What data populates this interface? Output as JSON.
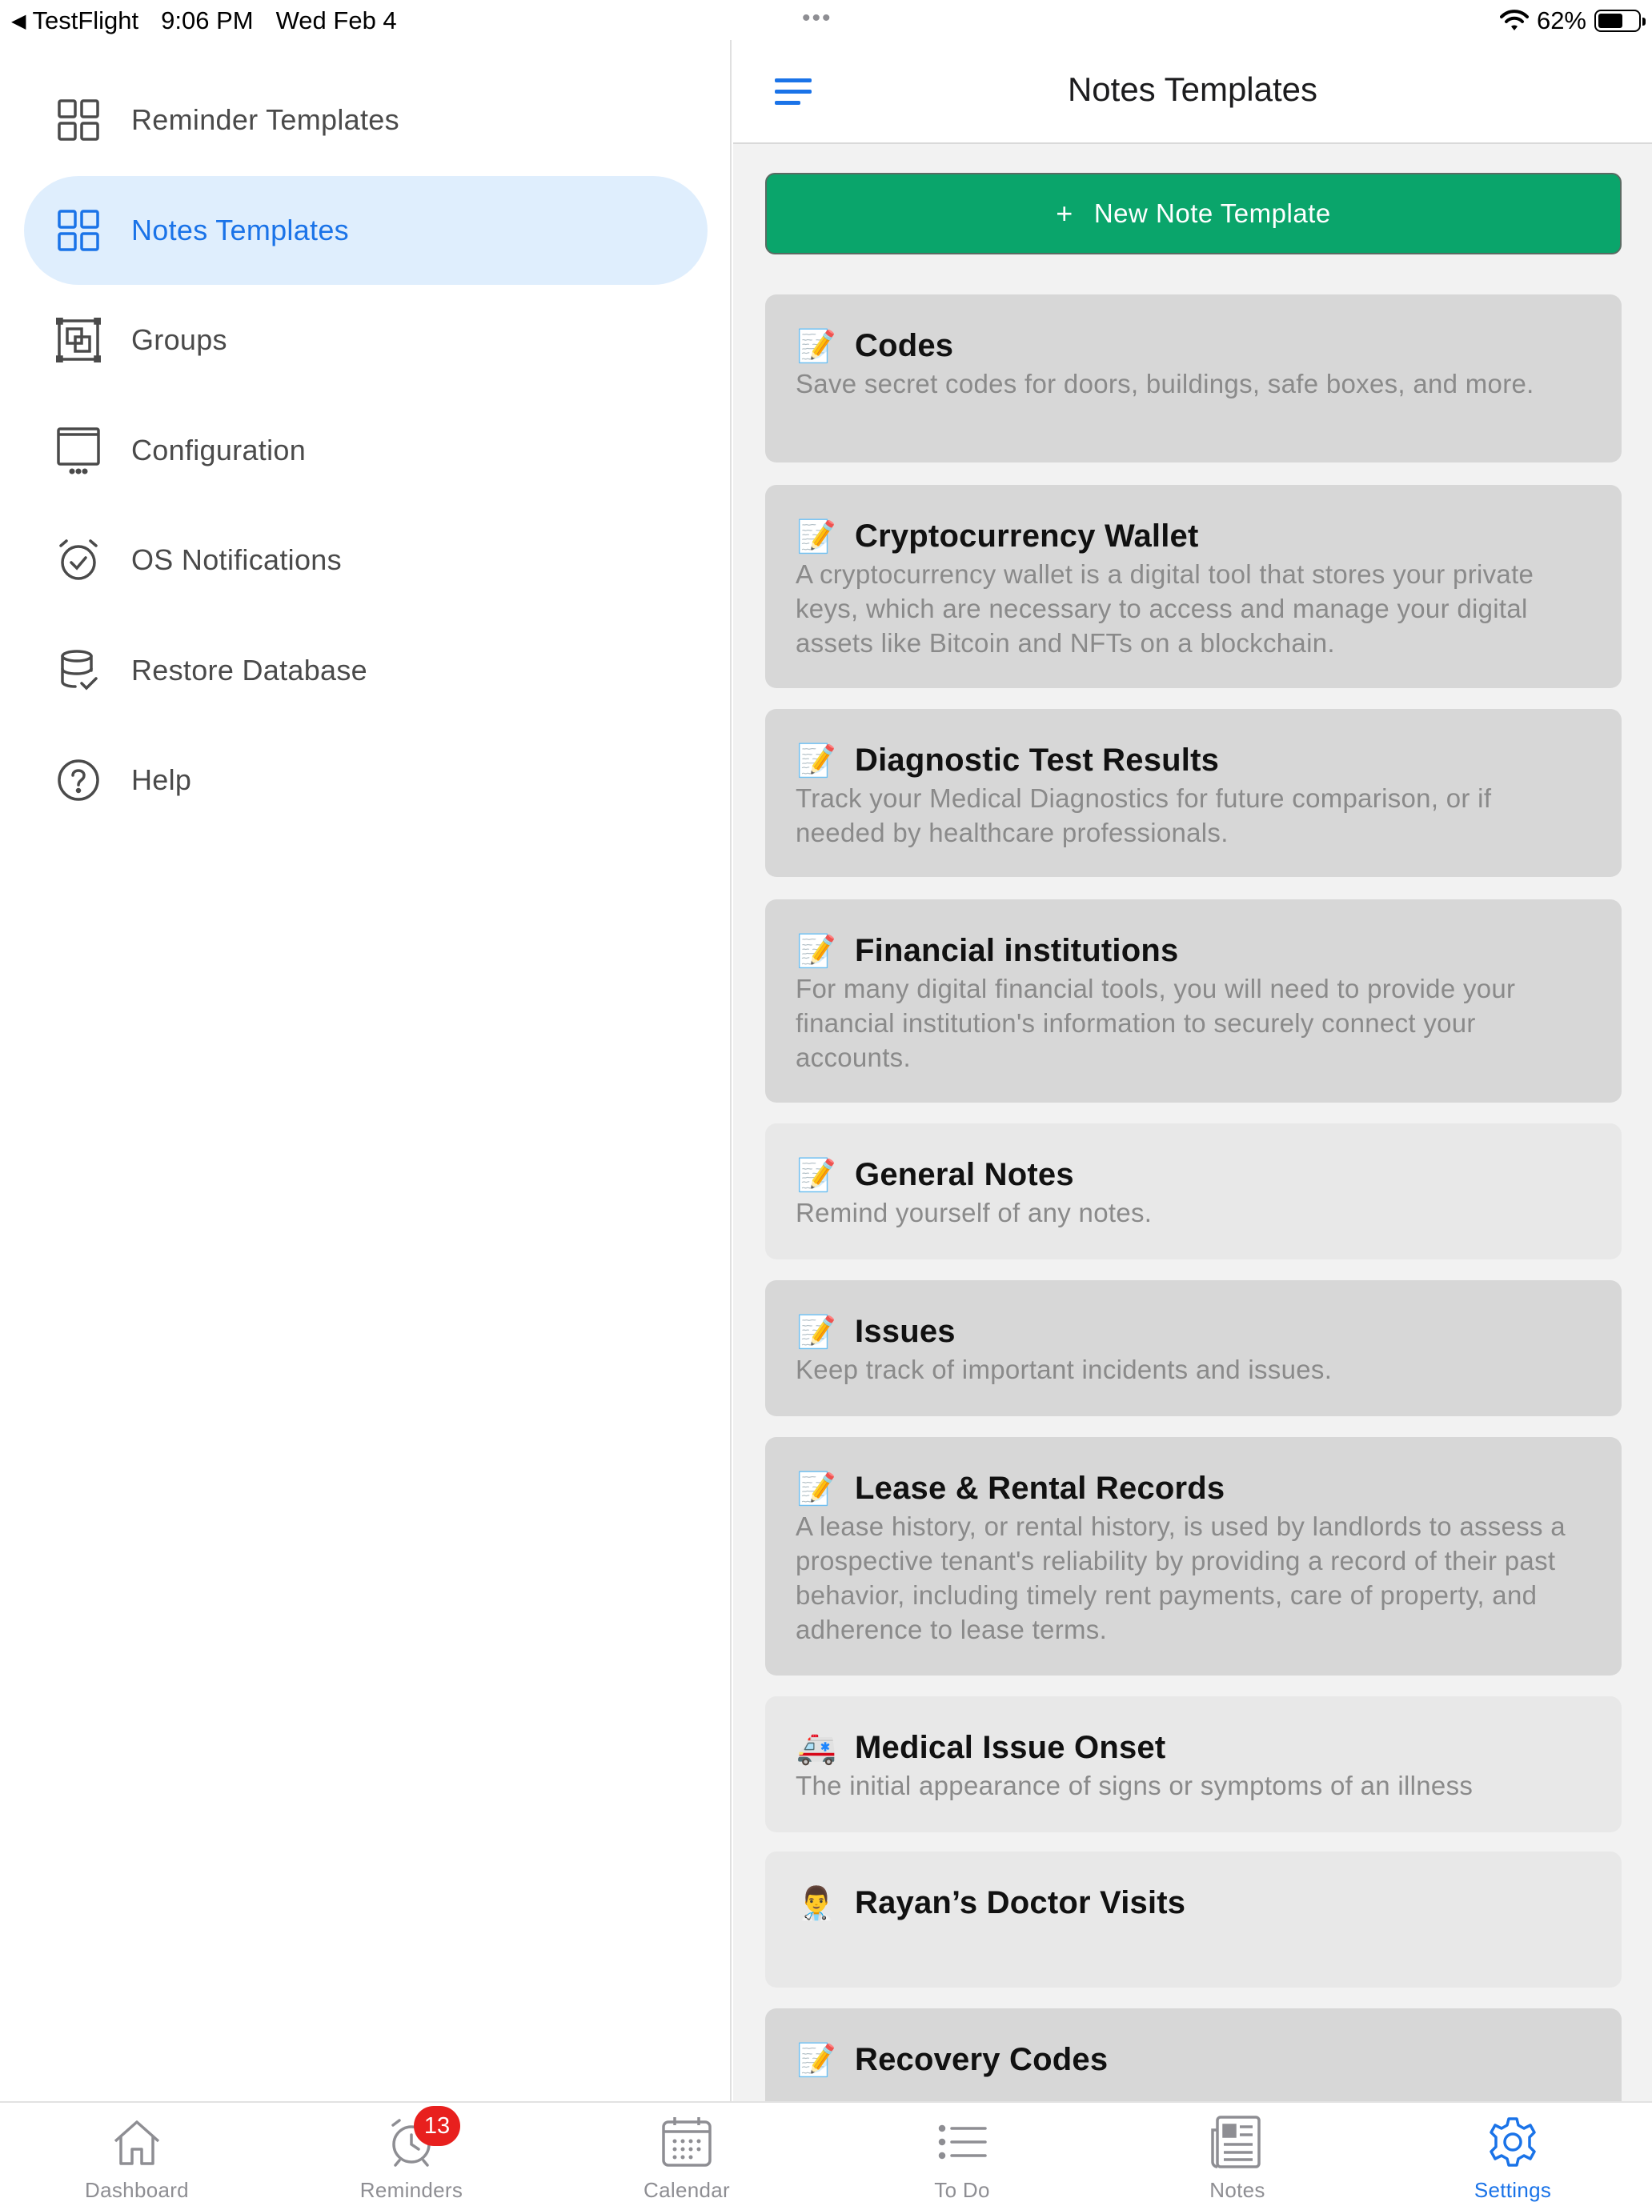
{
  "status_bar": {
    "back_app": "TestFlight",
    "time": "9:06 PM",
    "date": "Wed Feb 4",
    "dots": "•••",
    "battery_percent": "62%",
    "battery_level": 0.62
  },
  "sidebar": {
    "items": [
      {
        "label": "Reminder Templates",
        "icon": "grid-icon",
        "active": false
      },
      {
        "label": "Notes Templates",
        "icon": "grid-icon",
        "active": true
      },
      {
        "label": "Groups",
        "icon": "groups-icon",
        "active": false
      },
      {
        "label": "Configuration",
        "icon": "window-icon",
        "active": false
      },
      {
        "label": "OS Notifications",
        "icon": "alarm-check-icon",
        "active": false
      },
      {
        "label": "Restore Database",
        "icon": "database-icon",
        "active": false
      },
      {
        "label": "Help",
        "icon": "help-icon",
        "active": false
      }
    ]
  },
  "header": {
    "title": "Notes Templates",
    "menu_icon": "hamburger-icon"
  },
  "new_button": {
    "plus": "+",
    "label": "New Note Template"
  },
  "cards": [
    {
      "emoji": "📝",
      "title": "Codes",
      "description": "Save secret codes for doors, buildings, safe boxes, and more."
    },
    {
      "emoji": "📝",
      "title": "Cryptocurrency Wallet",
      "description": "A cryptocurrency wallet is a digital tool that stores your private keys, which are necessary to access and manage your digital assets like Bitcoin and NFTs on a blockchain."
    },
    {
      "emoji": "📝",
      "title": "Diagnostic Test Results",
      "description": "Track your Medical Diagnostics for future comparison, or if needed by healthcare professionals."
    },
    {
      "emoji": "📝",
      "title": "Financial institutions",
      "description": "For many digital financial tools, you will need to provide your financial institution's information to securely connect your accounts."
    },
    {
      "emoji": "📝",
      "title": "General Notes",
      "description": "Remind yourself of any notes."
    },
    {
      "emoji": "📝",
      "title": "Issues",
      "description": "Keep track of important incidents and issues."
    },
    {
      "emoji": "📝",
      "title": "Lease & Rental Records",
      "description": "A lease history, or rental history, is used by landlords to assess a prospective tenant's reliability by providing a record of their past behavior, including timely rent payments, care of property, and adherence to lease terms."
    },
    {
      "emoji": "🚑",
      "title": "Medical Issue Onset",
      "description": "The initial appearance of signs or symptoms of an illness"
    },
    {
      "emoji": "👨‍⚕️",
      "title": "Rayan’s Doctor Visits",
      "description": ""
    },
    {
      "emoji": "📝",
      "title": "Recovery Codes",
      "description": ""
    }
  ],
  "tab_bar": {
    "tabs": [
      {
        "label": "Dashboard",
        "icon": "home-icon",
        "active": false
      },
      {
        "label": "Reminders",
        "icon": "alarm-icon",
        "active": false,
        "badge": "13"
      },
      {
        "label": "Calendar",
        "icon": "calendar-icon",
        "active": false
      },
      {
        "label": "To Do",
        "icon": "list-icon",
        "active": false
      },
      {
        "label": "Notes",
        "icon": "newspaper-icon",
        "active": false
      },
      {
        "label": "Settings",
        "icon": "gear-icon",
        "active": true
      }
    ]
  },
  "colors": {
    "accent": "#1a73e8",
    "button_green": "#0aa56b",
    "badge_red": "#e8201e",
    "card_bg": "#d7d7d7",
    "active_bg": "#dfeefd"
  }
}
